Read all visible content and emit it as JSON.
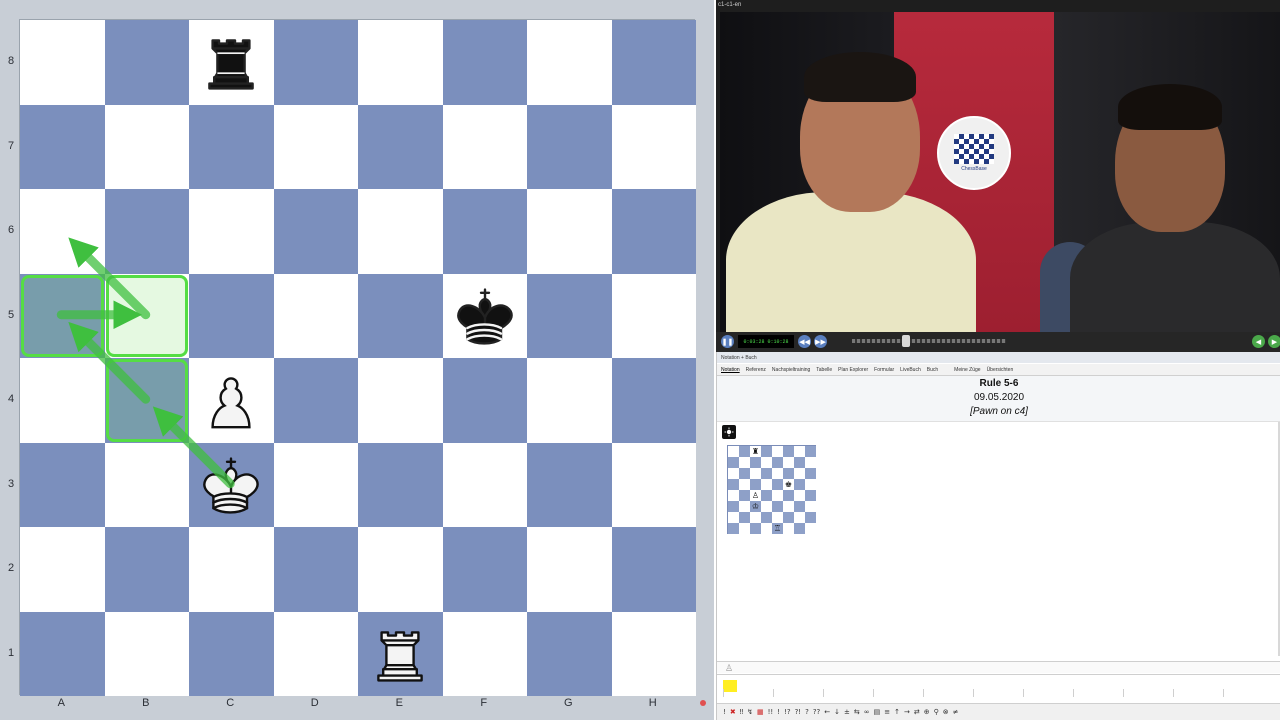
{
  "board": {
    "files": [
      "A",
      "B",
      "C",
      "D",
      "E",
      "F",
      "G",
      "H"
    ],
    "ranks": [
      "8",
      "7",
      "6",
      "5",
      "4",
      "3",
      "2",
      "1"
    ],
    "pieces": [
      {
        "square": "c8",
        "piece": "rook",
        "color": "black"
      },
      {
        "square": "f5",
        "piece": "king",
        "color": "black"
      },
      {
        "square": "c4",
        "piece": "pawn",
        "color": "white"
      },
      {
        "square": "c3",
        "piece": "king",
        "color": "white"
      },
      {
        "square": "e1",
        "piece": "rook",
        "color": "white"
      }
    ],
    "highlighted_squares": [
      "a5",
      "b5",
      "b4"
    ],
    "arrows": [
      {
        "from": "c3",
        "to": "b4"
      },
      {
        "from": "b4",
        "to": "a5"
      },
      {
        "from": "a5",
        "to": "b5"
      },
      {
        "from": "b5",
        "to": "a6"
      }
    ],
    "light_color": "#ffffff",
    "dark_color": "#7b8fbd",
    "highlight_color": "#55dd44"
  },
  "video": {
    "window_title": "c1-c1-en",
    "time_display": "0:03:28 0:10:28",
    "logo_text": "ChessBase"
  },
  "notation": {
    "caption": "Notation + Buch",
    "tabs": [
      "Notation",
      "Referenz",
      "Nachspieltraining",
      "Tabelle",
      "Plan Explorer",
      "Formular",
      "LiveBuch",
      "Buch",
      "Meine Züge",
      "Übersichten"
    ],
    "game_title": "Rule 5-6",
    "game_date": "09.05.2020",
    "annotation": "[Pawn on c4]"
  },
  "toolbar": {
    "icons": [
      "!",
      "✖",
      "‼",
      "↯",
      "▦",
      "!!",
      "!",
      "!?",
      "?!",
      "?",
      "??",
      "←",
      "↓",
      "±",
      "⇆",
      "∞",
      "▤",
      "≡",
      "↑",
      "→",
      "⇄",
      "⊕",
      "⚲",
      "⊗",
      "≠"
    ]
  }
}
